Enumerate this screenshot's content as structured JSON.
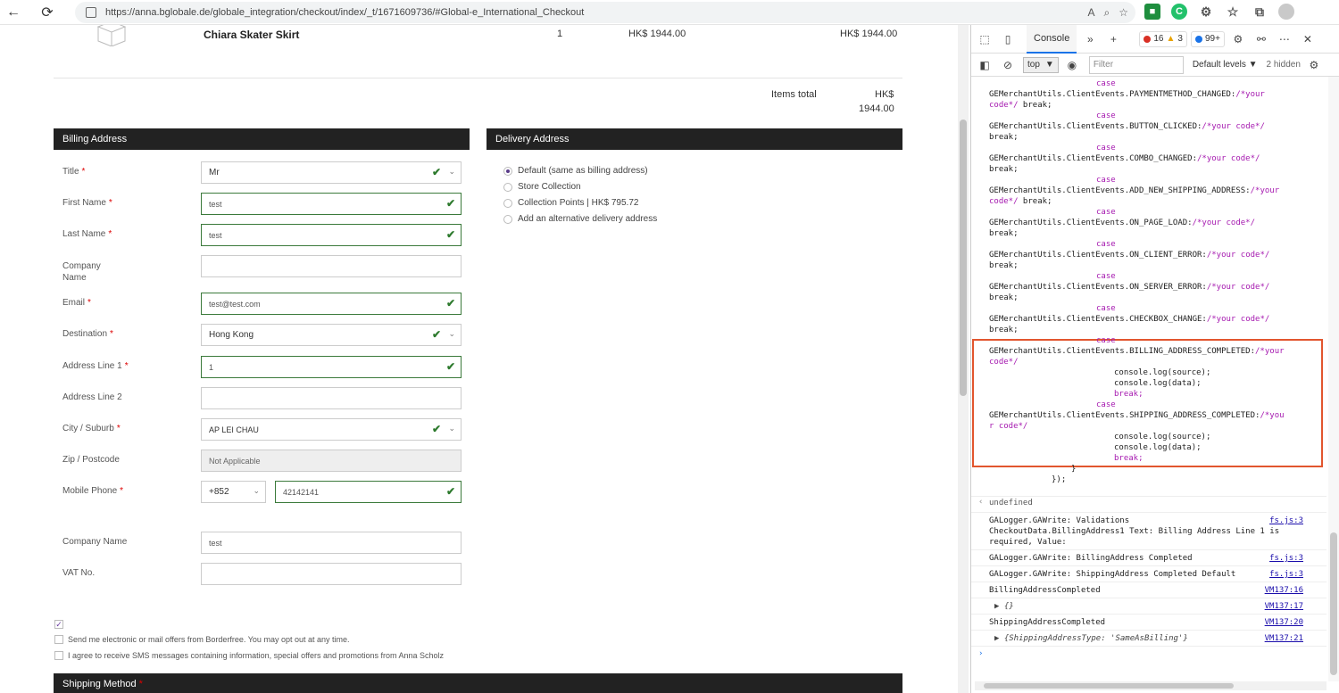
{
  "browser": {
    "url": "https://anna.bglobale.de/globale_integration/checkout/index/_t/1671609736/#Global-e_International_Checkout",
    "back_icon": "←",
    "reload_icon": "⟳"
  },
  "product": {
    "name": "Chiara Skater Skirt",
    "qty": "1",
    "price": "HK$ 1944.00",
    "total": "HK$ 1944.00"
  },
  "summary": {
    "label": "Items total",
    "currency": "HK$",
    "value": "1944.00"
  },
  "billing": {
    "heading": "Billing Address",
    "fields": {
      "title": {
        "label": "Title",
        "value": "Mr"
      },
      "first_name": {
        "label": "First Name",
        "value": "test"
      },
      "last_name": {
        "label": "Last Name",
        "value": "test"
      },
      "company_line1": "Company",
      "company_line2": "Name",
      "email": {
        "label": "Email",
        "value": "test@test.com"
      },
      "destination": {
        "label": "Destination",
        "value": "Hong Kong"
      },
      "address1": {
        "label": "Address Line 1",
        "value": "1"
      },
      "address2": {
        "label": "Address Line 2",
        "value": ""
      },
      "city": {
        "label": "City / Suburb",
        "value": "AP LEI CHAU"
      },
      "zip": {
        "label": "Zip / Postcode",
        "value": "Not Applicable"
      },
      "mobile": {
        "label": "Mobile Phone",
        "code": "+852",
        "value": "42142141"
      },
      "company2": {
        "label": "Company Name",
        "value": "test"
      },
      "vat": {
        "label": "VAT No.",
        "value": ""
      }
    },
    "star": "*"
  },
  "delivery": {
    "heading": "Delivery Address",
    "options": [
      "Default (same as billing address)",
      "Store Collection",
      "Collection Points | HK$ 795.72",
      "Add an alternative delivery address"
    ]
  },
  "consents": {
    "offers": "Send me electronic or mail offers from Borderfree. You may opt out at any time.",
    "sms": "I agree to receive SMS messages containing information, special offers and promotions from Anna Scholz"
  },
  "shipping": {
    "heading": "Shipping Method"
  },
  "devtools": {
    "tab": "Console",
    "errors": "16",
    "warnings": "3",
    "messages": "99+",
    "context": "top",
    "filter_placeholder": "Filter",
    "levels": "Default levels",
    "hidden": "2 hidden",
    "code": [
      {
        "kw": "case",
        "indent": 1
      },
      {
        "text": "GEMerchantUtils.ClientEvents.PAYMENTMETHOD_CHANGED:",
        "cm": "/*your"
      },
      {
        "cm": "code*/",
        "text": " break;"
      },
      {
        "kw": "case",
        "indent": 1
      },
      {
        "text": "GEMerchantUtils.ClientEvents.BUTTON_CLICKED:",
        "cm": "/*your code*/"
      },
      {
        "text": "break;"
      },
      {
        "kw": "case",
        "indent": 1
      },
      {
        "text": "GEMerchantUtils.ClientEvents.COMBO_CHANGED:",
        "cm": "/*your code*/"
      },
      {
        "text": "break;"
      },
      {
        "kw": "case",
        "indent": 1
      },
      {
        "text": "GEMerchantUtils.ClientEvents.ADD_NEW_SHIPPING_ADDRESS:",
        "cm": "/*your"
      },
      {
        "cm": "code*/",
        "text": " break;"
      },
      {
        "kw": "case",
        "indent": 1
      },
      {
        "text": "GEMerchantUtils.ClientEvents.ON_PAGE_LOAD:",
        "cm": "/*your code*/"
      },
      {
        "text": "break;"
      },
      {
        "kw": "case",
        "indent": 1
      },
      {
        "text": "GEMerchantUtils.ClientEvents.ON_CLIENT_ERROR:",
        "cm": "/*your code*/"
      },
      {
        "text": "break;"
      },
      {
        "kw": "case",
        "indent": 1
      },
      {
        "text": "GEMerchantUtils.ClientEvents.ON_SERVER_ERROR:",
        "cm": "/*your code*/"
      },
      {
        "text": "break;"
      },
      {
        "kw": "case",
        "indent": 1
      },
      {
        "text": "GEMerchantUtils.ClientEvents.CHECKBOX_CHANGE:",
        "cm": "/*your code*/"
      },
      {
        "text": "break;"
      },
      {
        "kw": "case",
        "indent": 1
      },
      {
        "text": "GEMerchantUtils.ClientEvents.BILLING_ADDRESS_COMPLETED:",
        "cm": "/*your"
      },
      {
        "cm": "code*/"
      },
      {
        "text": "console.log(source);",
        "indent": 1
      },
      {
        "text": "console.log(data);",
        "indent": 1
      },
      {
        "kw": "break;",
        "indent": 1
      },
      {
        "kw": "case",
        "indent": 1
      },
      {
        "text": "GEMerchantUtils.ClientEvents.SHIPPING_ADDRESS_COMPLETED:",
        "cm": "/*you"
      },
      {
        "cm": "r code*/"
      },
      {
        "text": "console.log(source);",
        "indent": 1
      },
      {
        "text": "console.log(data);",
        "indent": 1
      },
      {
        "kw": "break;",
        "indent": 1
      },
      {
        "text": "}",
        "indent": 2
      },
      {
        "text": "});",
        "indent": 3
      }
    ],
    "result": "undefined",
    "logs": [
      {
        "text": "GALogger.GAWrite: Validations\nCheckoutData.BillingAddress1 Text: Billing Address Line 1 is\nrequired, Value:",
        "src": "fs.js:3"
      },
      {
        "text": "GALogger.GAWrite: BillingAddress Completed",
        "src": "fs.js:3"
      },
      {
        "text": "GALogger.GAWrite: ShippingAddress Completed Default",
        "src": "fs.js:3"
      },
      {
        "text": "BillingAddressCompleted",
        "src": "VM137:16"
      },
      {
        "text": "▶ {}",
        "src": "VM137:17"
      },
      {
        "text": "ShippingAddressCompleted",
        "src": "VM137:20"
      },
      {
        "text": "▶ {ShippingAddressType: 'SameAsBilling'}",
        "src": "VM137:21"
      }
    ],
    "prompt": "›"
  }
}
